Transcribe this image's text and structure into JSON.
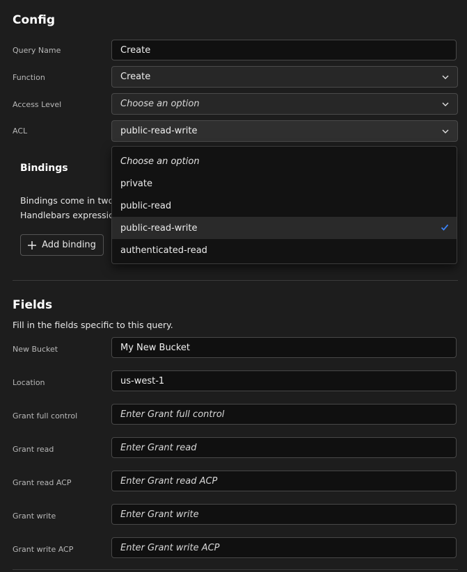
{
  "config": {
    "title": "Config",
    "query_name": {
      "label": "Query Name",
      "value": "Create"
    },
    "function": {
      "label": "Function",
      "value": "Create"
    },
    "access_level": {
      "label": "Access Level",
      "placeholder": "Choose an option"
    },
    "acl": {
      "label": "ACL",
      "value": "public-read-write",
      "options": [
        "Choose an option",
        "private",
        "public-read",
        "public-read-write",
        "authenticated-read"
      ],
      "selected": "public-read-write"
    }
  },
  "bindings": {
    "title": "Bindings",
    "description_line1": "Bindings come in two p",
    "description_line2": "Handlebars expression",
    "add_button": "Add binding"
  },
  "fields": {
    "title": "Fields",
    "subtitle": "Fill in the fields specific to this query.",
    "new_bucket": {
      "label": "New Bucket",
      "value": "My New Bucket"
    },
    "location": {
      "label": "Location",
      "value": "us-west-1"
    },
    "grant_full_control": {
      "label": "Grant full control",
      "placeholder": "Enter Grant full control"
    },
    "grant_read": {
      "label": "Grant read",
      "placeholder": "Enter Grant read"
    },
    "grant_read_acp": {
      "label": "Grant read ACP",
      "placeholder": "Enter Grant read ACP"
    },
    "grant_write": {
      "label": "Grant write",
      "placeholder": "Enter Grant write"
    },
    "grant_write_acp": {
      "label": "Grant write ACP",
      "placeholder": "Enter Grant write ACP"
    }
  },
  "colors": {
    "accent_check": "#3b82f6",
    "background": "#1d1d1d",
    "input_bg": "#101010"
  },
  "icons": {
    "select_arrow": "chevron-down-icon",
    "selected_mark": "check-icon",
    "add": "plus-icon"
  }
}
